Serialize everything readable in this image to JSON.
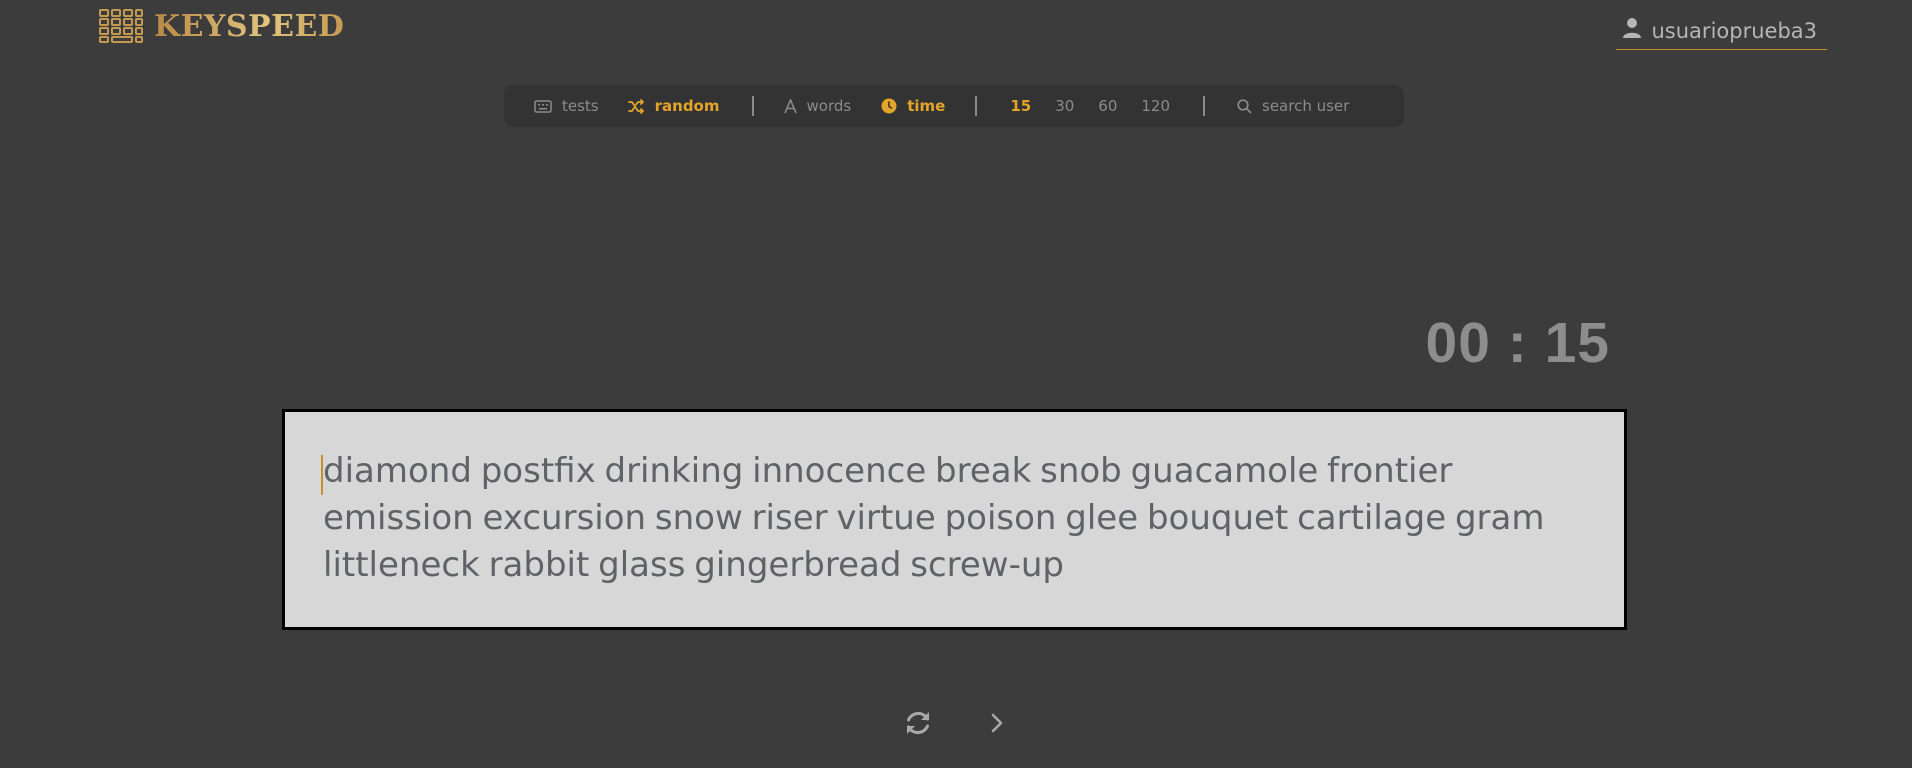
{
  "brand": {
    "name": "KEYSPEED",
    "icon": "keyboard-grid-icon"
  },
  "user": {
    "name": "usuarioprueba3",
    "icon": "user-icon"
  },
  "toolbar": {
    "tests_label": "tests",
    "random_label": "random",
    "words_label": "words",
    "time_label": "time",
    "durations": [
      "15",
      "30",
      "60",
      "120"
    ],
    "selected_duration": "15",
    "search_placeholder": "search user"
  },
  "timer": {
    "display": "00 : 15"
  },
  "typing": {
    "text": "diamond postfix drinking innocence break snob guacamole frontier emission excursion snow riser virtue poison glee bouquet cartilage gram littleneck rabbit glass gingerbread screw-up"
  },
  "controls": {
    "restart_icon": "refresh-icon",
    "next_icon": "chevron-right-icon"
  },
  "colors": {
    "accent": "#e2a429",
    "background": "#3c3c3c",
    "toolbar_bg": "#333333",
    "typing_bg": "#d7d7d7"
  }
}
